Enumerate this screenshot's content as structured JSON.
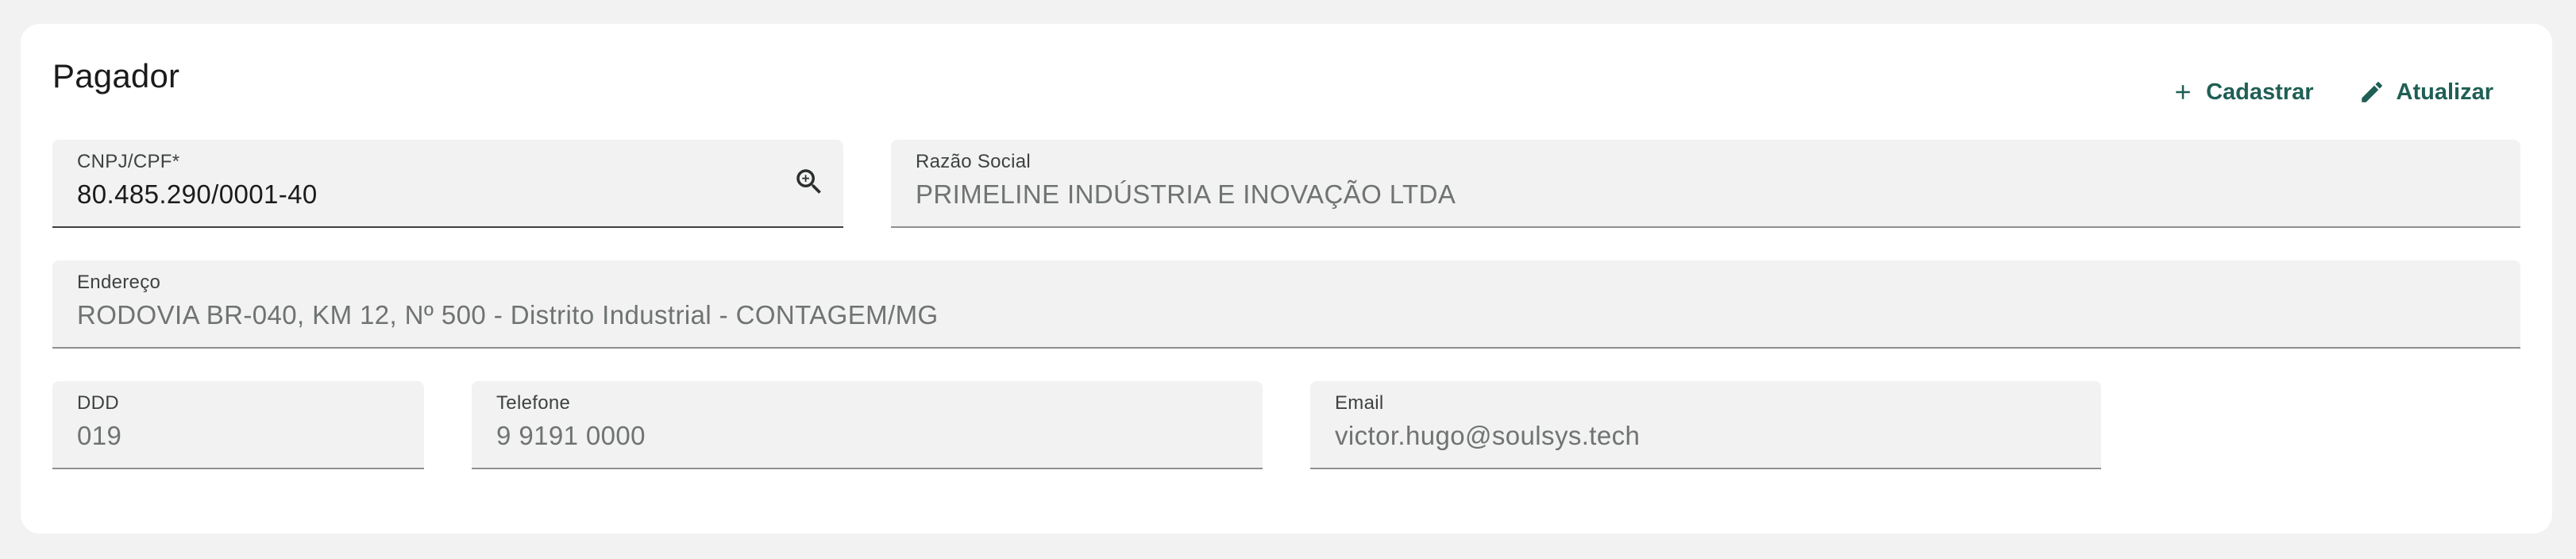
{
  "section": {
    "title": "Pagador"
  },
  "actions": {
    "register_label": "Cadastrar",
    "update_label": "Atualizar",
    "accent_color": "#1f5f55"
  },
  "fields": {
    "cnpj": {
      "label": "CNPJ/CPF*",
      "value": "80.485.290/0001-40",
      "icon": "zoom-in-icon"
    },
    "razao_social": {
      "label": "Razão Social",
      "value": "PRIMELINE INDÚSTRIA E INOVAÇÃO LTDA"
    },
    "endereco": {
      "label": "Endereço",
      "value": "RODOVIA BR-040, KM 12, Nº 500 - Distrito Industrial - CONTAGEM/MG"
    },
    "ddd": {
      "label": "DDD",
      "value": "019"
    },
    "telefone": {
      "label": "Telefone",
      "value": "9 9191 0000"
    },
    "email": {
      "label": "Email",
      "value": "victor.hugo@soulsys.tech"
    }
  }
}
